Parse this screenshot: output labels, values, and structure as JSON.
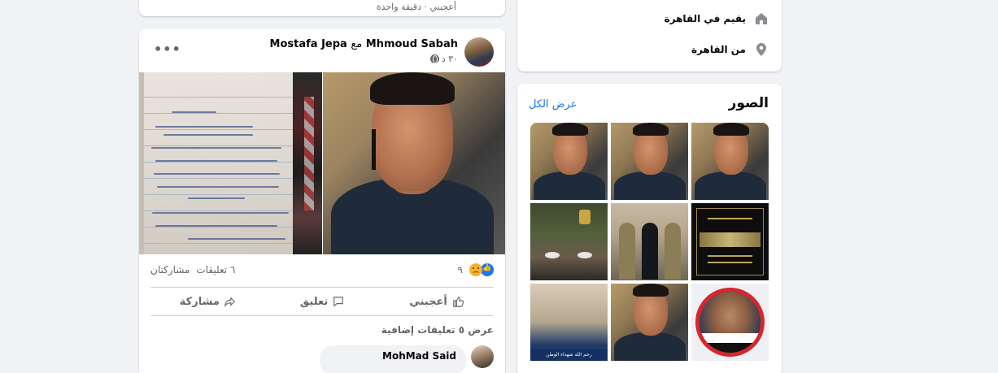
{
  "previous_post": {
    "meta": "أعجبني · دقيقة واحدة"
  },
  "post": {
    "author": "Mhmoud Sabah",
    "with_label": "مع",
    "tagged": "Mostafa Jepa",
    "time": "٣٠ د",
    "more_icon": "more-dots-icon",
    "reaction_count": "٩",
    "comments_count": "٦ تعليقات",
    "shares_label": "مشاركتان",
    "actions": {
      "like": "أعجبني",
      "comment": "تعليق",
      "share": "مشاركة"
    },
    "view_more_comments": "عرض ٥ تعليقات إضافية",
    "comment": {
      "author": "MohMad Said"
    }
  },
  "intro": {
    "lives_in": "يقيم في القاهرة",
    "from": "من القاهرة"
  },
  "photos": {
    "title": "الصور",
    "see_all": "عرض الكل",
    "memorial_caption": "رحم الله شهداء الوطن"
  },
  "colors": {
    "accent": "#1877f2",
    "page_bg": "#f0f2f5",
    "secondary_text": "#65676b"
  }
}
